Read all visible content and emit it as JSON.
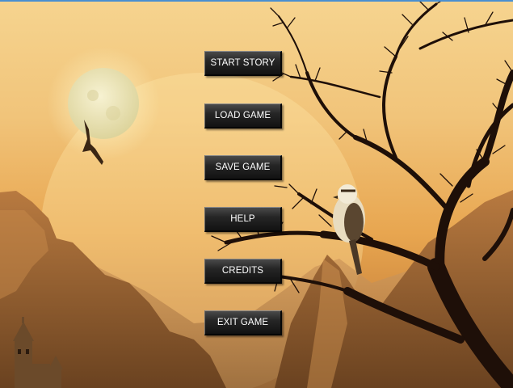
{
  "menu": {
    "start": "START STORY",
    "load": "LOAD GAME",
    "save": "SAVE GAME",
    "help": "HELP",
    "credits": "CREDITS",
    "exit": "EXIT GAME"
  },
  "colors": {
    "sky": "#f1c47a",
    "moon": "#f2edc4",
    "button": "#1c1c1c",
    "button_text": "#ffffff",
    "tree": "#1e0f08"
  }
}
